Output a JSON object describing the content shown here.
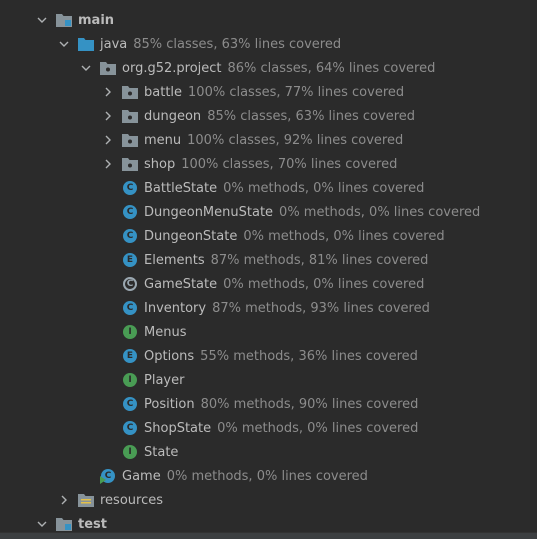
{
  "tree": [
    {
      "id": "main",
      "label": "main",
      "coverage": "",
      "icon": "module-folder-icon",
      "expanded": true,
      "bold": true
    },
    {
      "id": "java",
      "label": "java",
      "coverage": "85% classes, 63% lines covered",
      "icon": "source-folder-icon",
      "expanded": true
    },
    {
      "id": "pkg",
      "label": "org.g52.project",
      "coverage": "86% classes, 64% lines covered",
      "icon": "package-icon",
      "expanded": true
    },
    {
      "id": "battle",
      "label": "battle",
      "coverage": "100% classes, 77% lines covered",
      "icon": "package-icon",
      "expanded": false
    },
    {
      "id": "dungeon",
      "label": "dungeon",
      "coverage": "85% classes, 63% lines covered",
      "icon": "package-icon",
      "expanded": false
    },
    {
      "id": "menu",
      "label": "menu",
      "coverage": "100% classes, 92% lines covered",
      "icon": "package-icon",
      "expanded": false
    },
    {
      "id": "shop",
      "label": "shop",
      "coverage": "100% classes, 70% lines covered",
      "icon": "package-icon",
      "expanded": false
    },
    {
      "id": "battlestate",
      "label": "BattleState",
      "coverage": "0% methods, 0% lines covered",
      "icon": "class-icon",
      "letter": "C"
    },
    {
      "id": "dungeonmenustate",
      "label": "DungeonMenuState",
      "coverage": "0% methods, 0% lines covered",
      "icon": "class-icon",
      "letter": "C"
    },
    {
      "id": "dungeonstate",
      "label": "DungeonState",
      "coverage": "0% methods, 0% lines covered",
      "icon": "class-icon",
      "letter": "C"
    },
    {
      "id": "elements",
      "label": "Elements",
      "coverage": "87% methods, 81% lines covered",
      "icon": "enum-icon",
      "letter": "E"
    },
    {
      "id": "gamestate",
      "label": "GameState",
      "coverage": "0% methods, 0% lines covered",
      "icon": "abstract-class-icon",
      "letter": "C"
    },
    {
      "id": "inventory",
      "label": "Inventory",
      "coverage": "87% methods, 93% lines covered",
      "icon": "class-icon",
      "letter": "C"
    },
    {
      "id": "menus",
      "label": "Menus",
      "coverage": "",
      "icon": "interface-icon",
      "letter": "I"
    },
    {
      "id": "options",
      "label": "Options",
      "coverage": "55% methods, 36% lines covered",
      "icon": "enum-icon",
      "letter": "E"
    },
    {
      "id": "player",
      "label": "Player",
      "coverage": "",
      "icon": "interface-icon",
      "letter": "I"
    },
    {
      "id": "position",
      "label": "Position",
      "coverage": "80% methods, 90% lines covered",
      "icon": "class-icon",
      "letter": "C"
    },
    {
      "id": "shopstate",
      "label": "ShopState",
      "coverage": "0% methods, 0% lines covered",
      "icon": "class-icon",
      "letter": "C"
    },
    {
      "id": "state",
      "label": "State",
      "coverage": "",
      "icon": "interface-icon",
      "letter": "I"
    },
    {
      "id": "game",
      "label": "Game",
      "coverage": "0% methods, 0% lines covered",
      "icon": "main-class-icon",
      "letter": "C"
    },
    {
      "id": "resources",
      "label": "resources",
      "coverage": "",
      "icon": "resources-folder-icon",
      "expanded": false
    },
    {
      "id": "test",
      "label": "test",
      "coverage": "",
      "icon": "module-folder-icon",
      "expanded": true,
      "bold": true
    }
  ],
  "colors": {
    "class": "#3592c4",
    "enum": "#3592c4",
    "interface": "#499c54",
    "folder": "#87939a",
    "source_folder": "#3592c4"
  }
}
